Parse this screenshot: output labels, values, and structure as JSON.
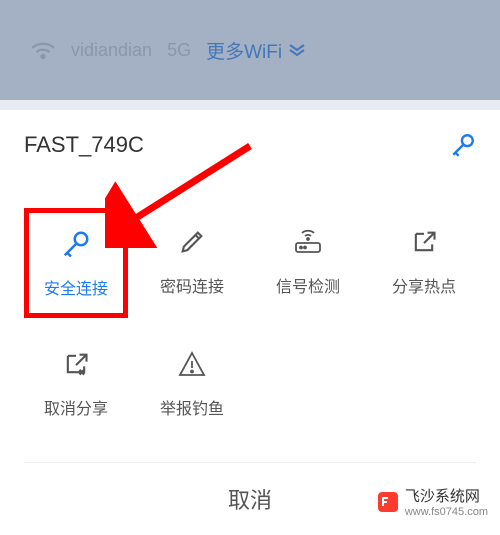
{
  "background": {
    "ssid": "vidiandian",
    "band": "5G",
    "more_label": "更多WiFi"
  },
  "sheet": {
    "title": "FAST_749C"
  },
  "options": {
    "secure_connect": "安全连接",
    "password_connect": "密码连接",
    "signal_check": "信号检测",
    "share_hotspot": "分享热点",
    "cancel_share": "取消分享",
    "report_phishing": "举报钓鱼"
  },
  "cancel_label": "取消",
  "watermark": {
    "main": "飞沙系统网",
    "sub": "www.fs0745.com"
  },
  "colors": {
    "accent": "#1e7af0",
    "highlight": "#ff0000"
  }
}
